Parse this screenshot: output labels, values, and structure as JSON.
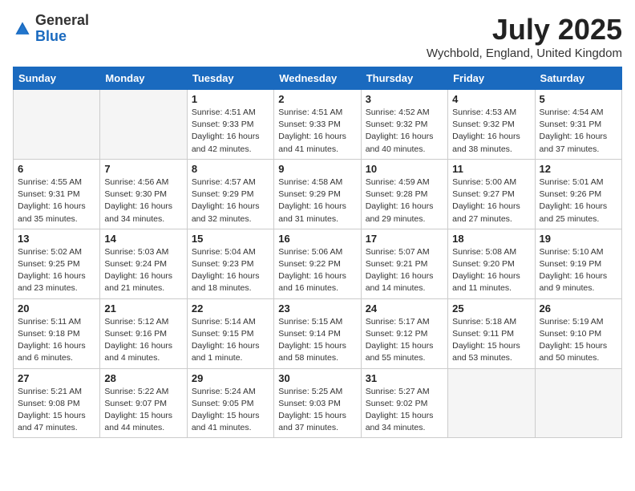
{
  "header": {
    "logo_general": "General",
    "logo_blue": "Blue",
    "month_year": "July 2025",
    "location": "Wychbold, England, United Kingdom"
  },
  "columns": [
    "Sunday",
    "Monday",
    "Tuesday",
    "Wednesday",
    "Thursday",
    "Friday",
    "Saturday"
  ],
  "weeks": [
    [
      {
        "day": "",
        "detail": ""
      },
      {
        "day": "",
        "detail": ""
      },
      {
        "day": "1",
        "detail": "Sunrise: 4:51 AM\nSunset: 9:33 PM\nDaylight: 16 hours\nand 42 minutes."
      },
      {
        "day": "2",
        "detail": "Sunrise: 4:51 AM\nSunset: 9:33 PM\nDaylight: 16 hours\nand 41 minutes."
      },
      {
        "day": "3",
        "detail": "Sunrise: 4:52 AM\nSunset: 9:32 PM\nDaylight: 16 hours\nand 40 minutes."
      },
      {
        "day": "4",
        "detail": "Sunrise: 4:53 AM\nSunset: 9:32 PM\nDaylight: 16 hours\nand 38 minutes."
      },
      {
        "day": "5",
        "detail": "Sunrise: 4:54 AM\nSunset: 9:31 PM\nDaylight: 16 hours\nand 37 minutes."
      }
    ],
    [
      {
        "day": "6",
        "detail": "Sunrise: 4:55 AM\nSunset: 9:31 PM\nDaylight: 16 hours\nand 35 minutes."
      },
      {
        "day": "7",
        "detail": "Sunrise: 4:56 AM\nSunset: 9:30 PM\nDaylight: 16 hours\nand 34 minutes."
      },
      {
        "day": "8",
        "detail": "Sunrise: 4:57 AM\nSunset: 9:29 PM\nDaylight: 16 hours\nand 32 minutes."
      },
      {
        "day": "9",
        "detail": "Sunrise: 4:58 AM\nSunset: 9:29 PM\nDaylight: 16 hours\nand 31 minutes."
      },
      {
        "day": "10",
        "detail": "Sunrise: 4:59 AM\nSunset: 9:28 PM\nDaylight: 16 hours\nand 29 minutes."
      },
      {
        "day": "11",
        "detail": "Sunrise: 5:00 AM\nSunset: 9:27 PM\nDaylight: 16 hours\nand 27 minutes."
      },
      {
        "day": "12",
        "detail": "Sunrise: 5:01 AM\nSunset: 9:26 PM\nDaylight: 16 hours\nand 25 minutes."
      }
    ],
    [
      {
        "day": "13",
        "detail": "Sunrise: 5:02 AM\nSunset: 9:25 PM\nDaylight: 16 hours\nand 23 minutes."
      },
      {
        "day": "14",
        "detail": "Sunrise: 5:03 AM\nSunset: 9:24 PM\nDaylight: 16 hours\nand 21 minutes."
      },
      {
        "day": "15",
        "detail": "Sunrise: 5:04 AM\nSunset: 9:23 PM\nDaylight: 16 hours\nand 18 minutes."
      },
      {
        "day": "16",
        "detail": "Sunrise: 5:06 AM\nSunset: 9:22 PM\nDaylight: 16 hours\nand 16 minutes."
      },
      {
        "day": "17",
        "detail": "Sunrise: 5:07 AM\nSunset: 9:21 PM\nDaylight: 16 hours\nand 14 minutes."
      },
      {
        "day": "18",
        "detail": "Sunrise: 5:08 AM\nSunset: 9:20 PM\nDaylight: 16 hours\nand 11 minutes."
      },
      {
        "day": "19",
        "detail": "Sunrise: 5:10 AM\nSunset: 9:19 PM\nDaylight: 16 hours\nand 9 minutes."
      }
    ],
    [
      {
        "day": "20",
        "detail": "Sunrise: 5:11 AM\nSunset: 9:18 PM\nDaylight: 16 hours\nand 6 minutes."
      },
      {
        "day": "21",
        "detail": "Sunrise: 5:12 AM\nSunset: 9:16 PM\nDaylight: 16 hours\nand 4 minutes."
      },
      {
        "day": "22",
        "detail": "Sunrise: 5:14 AM\nSunset: 9:15 PM\nDaylight: 16 hours\nand 1 minute."
      },
      {
        "day": "23",
        "detail": "Sunrise: 5:15 AM\nSunset: 9:14 PM\nDaylight: 15 hours\nand 58 minutes."
      },
      {
        "day": "24",
        "detail": "Sunrise: 5:17 AM\nSunset: 9:12 PM\nDaylight: 15 hours\nand 55 minutes."
      },
      {
        "day": "25",
        "detail": "Sunrise: 5:18 AM\nSunset: 9:11 PM\nDaylight: 15 hours\nand 53 minutes."
      },
      {
        "day": "26",
        "detail": "Sunrise: 5:19 AM\nSunset: 9:10 PM\nDaylight: 15 hours\nand 50 minutes."
      }
    ],
    [
      {
        "day": "27",
        "detail": "Sunrise: 5:21 AM\nSunset: 9:08 PM\nDaylight: 15 hours\nand 47 minutes."
      },
      {
        "day": "28",
        "detail": "Sunrise: 5:22 AM\nSunset: 9:07 PM\nDaylight: 15 hours\nand 44 minutes."
      },
      {
        "day": "29",
        "detail": "Sunrise: 5:24 AM\nSunset: 9:05 PM\nDaylight: 15 hours\nand 41 minutes."
      },
      {
        "day": "30",
        "detail": "Sunrise: 5:25 AM\nSunset: 9:03 PM\nDaylight: 15 hours\nand 37 minutes."
      },
      {
        "day": "31",
        "detail": "Sunrise: 5:27 AM\nSunset: 9:02 PM\nDaylight: 15 hours\nand 34 minutes."
      },
      {
        "day": "",
        "detail": ""
      },
      {
        "day": "",
        "detail": ""
      }
    ]
  ]
}
